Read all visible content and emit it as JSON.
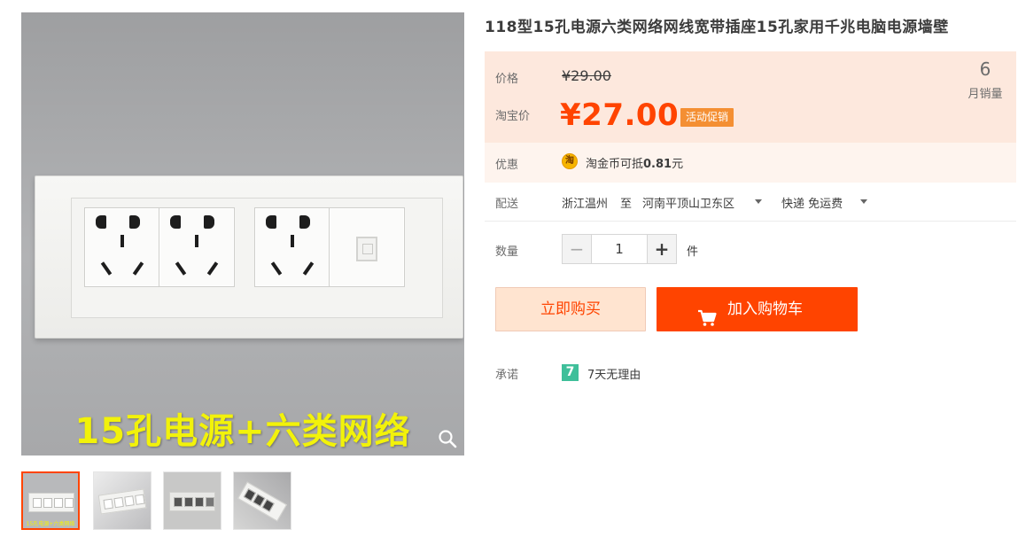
{
  "product": {
    "title": "118型15孔电源六类网络网线宽带插座15孔家用千兆电脑电源墙壁",
    "image_caption": "15孔电源+六类网络",
    "thumb_caption": "15孔电源+六类网络"
  },
  "price": {
    "label": "价格",
    "original": "¥29.00",
    "promo_label": "淘宝价",
    "current": "¥27.00",
    "promo_tag": "活动促销",
    "sales_count": "6",
    "sales_label": "月销量"
  },
  "discount": {
    "label": "优惠",
    "icon_char": "淘",
    "text_prefix": "淘金币可抵",
    "text_amount": "0.81",
    "text_suffix": "元"
  },
  "shipping": {
    "label": "配送",
    "origin": "浙江温州",
    "to_word": "至",
    "destination": "河南平顶山卫东区",
    "method": "快递 免运费"
  },
  "quantity": {
    "label": "数量",
    "minus": "−",
    "value": "1",
    "plus": "+",
    "unit": "件"
  },
  "actions": {
    "buy_now": "立即购买",
    "add_to_cart": "加入购物车"
  },
  "promise": {
    "label": "承诺",
    "icon_char": "7",
    "text": "7天无理由"
  },
  "colors": {
    "accent": "#ff4400",
    "price_bg": "#fde8dd",
    "promo_tag": "#f48f33",
    "promise_icon": "#3fbf9a"
  },
  "icons": [
    "search-zoom-icon",
    "taobao-coin-icon",
    "caret-down-icon",
    "shopping-cart-icon",
    "seven-day-return-icon"
  ]
}
